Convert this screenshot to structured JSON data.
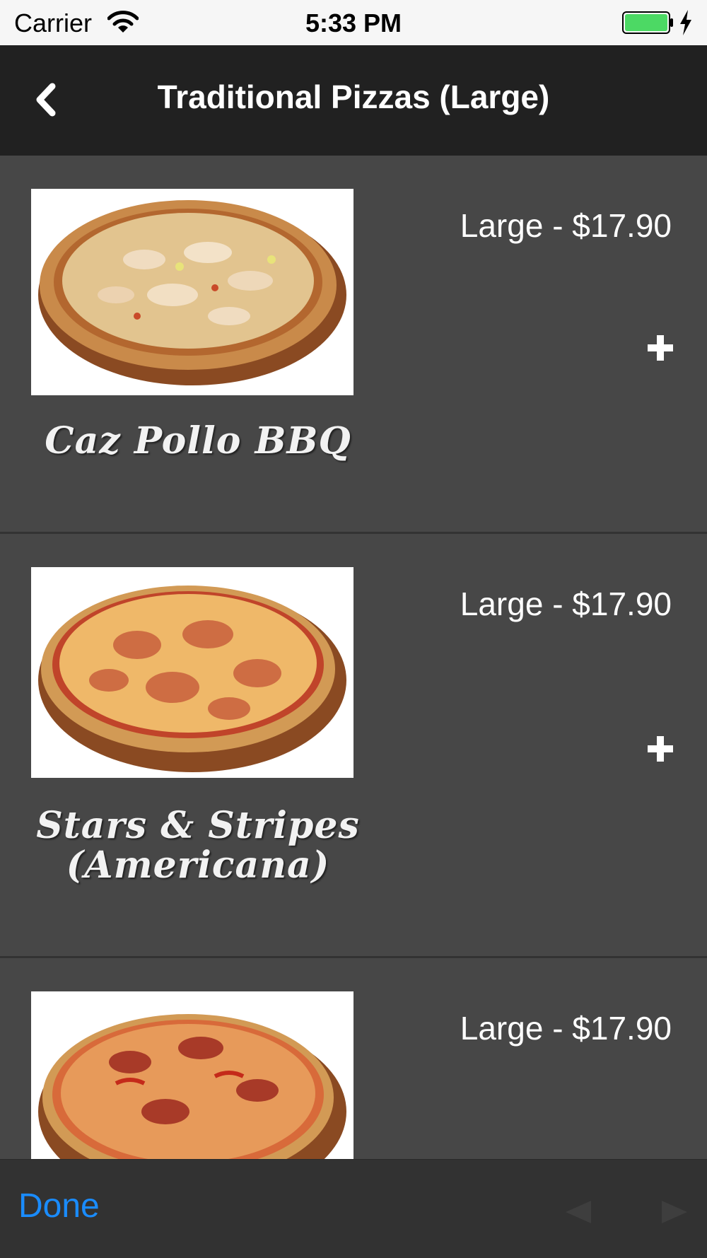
{
  "status_bar": {
    "carrier": "Carrier",
    "time": "5:33 PM"
  },
  "nav": {
    "title": "Traditional Pizzas (Large)",
    "back_icon": "chevron-left-icon"
  },
  "items": [
    {
      "name": "Caz Pollo BBQ",
      "price": "Large - $17.90"
    },
    {
      "name": "Stars & Stripes (Americana)",
      "price": "Large - $17.90"
    },
    {
      "name": "",
      "price": "Large - $17.90"
    }
  ],
  "toolbar": {
    "done_label": "Done",
    "prev_icon": "previous-arrow-icon",
    "next_icon": "next-arrow-icon"
  },
  "colors": {
    "accent": "#1a8cff",
    "nav_bg": "#212121",
    "list_bg": "#474747",
    "battery": "#4cd964"
  }
}
